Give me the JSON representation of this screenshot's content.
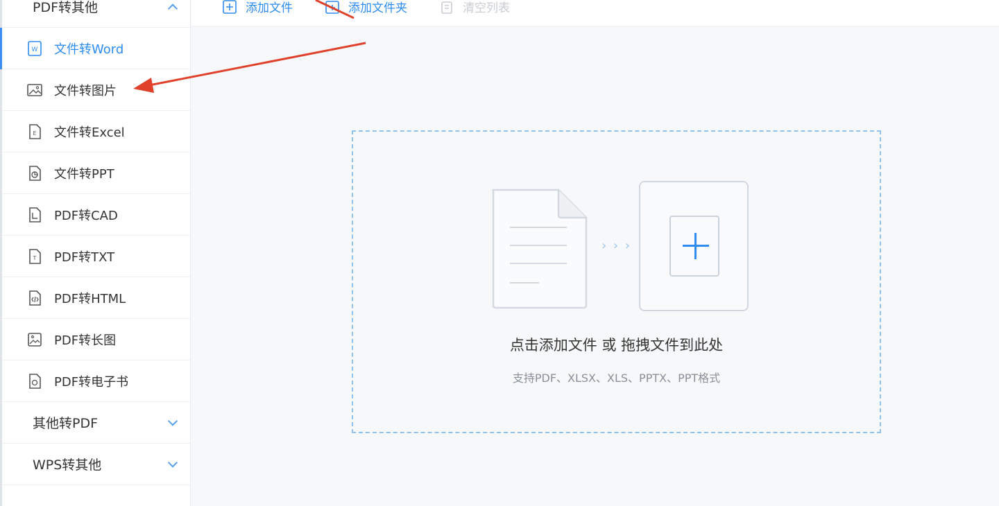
{
  "sidebar": {
    "group_pdf_other": "PDF转其他",
    "items": [
      {
        "label": "文件转Word",
        "icon": "word-file-icon"
      },
      {
        "label": "文件转图片",
        "icon": "image-file-icon"
      },
      {
        "label": "文件转Excel",
        "icon": "excel-file-icon"
      },
      {
        "label": "文件转PPT",
        "icon": "ppt-file-icon"
      },
      {
        "label": "PDF转CAD",
        "icon": "cad-file-icon"
      },
      {
        "label": "PDF转TXT",
        "icon": "txt-file-icon"
      },
      {
        "label": "PDF转HTML",
        "icon": "html-file-icon"
      },
      {
        "label": "PDF转长图",
        "icon": "long-image-icon"
      },
      {
        "label": "PDF转电子书",
        "icon": "ebook-file-icon"
      }
    ],
    "group_other_pdf": "其他转PDF",
    "group_wps_other": "WPS转其他"
  },
  "toolbar": {
    "add_file": "添加文件",
    "add_folder": "添加文件夹",
    "clear_list": "清空列表"
  },
  "dropzone": {
    "title": "点击添加文件 或 拖拽文件到此处",
    "subtitle": "支持PDF、XLSX、XLS、PPTX、PPT格式",
    "arrows": "› › ›"
  },
  "colors": {
    "accent": "#2d8cf0",
    "annotation": "#e0412b",
    "dropzone_border": "#8fc2ec"
  },
  "active_item": "文件转Word"
}
